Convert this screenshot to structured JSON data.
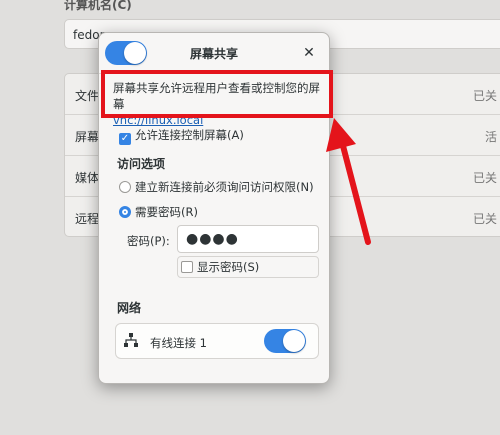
{
  "background": {
    "computer_name_label": "计算机名(C)",
    "computer_name_value": "fedora",
    "rows": [
      {
        "label": "文件",
        "value": "已关"
      },
      {
        "label": "屏幕",
        "value": "活"
      },
      {
        "label": "媒体",
        "value": "已关"
      },
      {
        "label": "远程",
        "value": "已关"
      }
    ]
  },
  "dialog": {
    "title": "屏幕共享",
    "enabled": true,
    "description": "屏幕共享允许远程用户查看或控制您的屏幕",
    "vnc_link": "vnc://linux.local",
    "allow_control_label": "允许连接控制屏幕(A)",
    "allow_control_checked": true,
    "access_section_title": "访问选项",
    "access_options": [
      {
        "label": "建立新连接前必须询问访问权限(N)",
        "selected": false
      },
      {
        "label": "需要密码(R)",
        "selected": true
      }
    ],
    "password_label": "密码(P):",
    "password_value": "●●●●",
    "show_password_label": "显示密码(S)",
    "show_password_checked": false,
    "network_section_title": "网络",
    "network_label": "有线连接 1",
    "network_enabled": true
  },
  "icons": {
    "close": "close-icon",
    "network": "network-icon",
    "check": "check-icon"
  },
  "colors": {
    "accent": "#3584e4",
    "highlight_red": "#e4141b",
    "link": "#1a5fb4"
  }
}
